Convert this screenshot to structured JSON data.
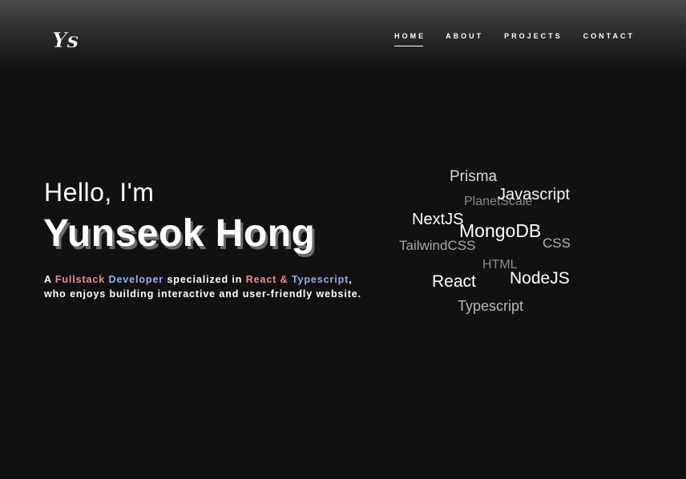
{
  "brand": {
    "logo_text": "Ys"
  },
  "nav": {
    "items": [
      {
        "label": "HOME",
        "active": true
      },
      {
        "label": "ABOUT",
        "active": false
      },
      {
        "label": "PROJECTS",
        "active": false
      },
      {
        "label": "CONTACT",
        "active": false
      }
    ]
  },
  "hero": {
    "greeting": "Hello, I'm",
    "name": "Yunseok Hong",
    "tagline": {
      "a": "A",
      "fullstack": "Fullstack",
      "developer": "Developer",
      "specialized_in": "specialized in",
      "react": "React",
      "amp": "&",
      "typescript": "Typescript",
      "comma": ",",
      "line2": "who enjoys building interactive and user-friendly website."
    }
  },
  "skills_cloud": {
    "words": [
      {
        "text": "Prisma",
        "tone": "light"
      },
      {
        "text": "PlanetScale",
        "tone": "dim"
      },
      {
        "text": "Javascript",
        "tone": "bright"
      },
      {
        "text": "NextJS",
        "tone": "bright"
      },
      {
        "text": "MongoDB",
        "tone": "bright"
      },
      {
        "text": "TailwindCSS",
        "tone": "mid"
      },
      {
        "text": "CSS",
        "tone": "mid"
      },
      {
        "text": "HTML",
        "tone": "dim"
      },
      {
        "text": "React",
        "tone": "bright"
      },
      {
        "text": "NodeJS",
        "tone": "bright"
      },
      {
        "text": "Typescript",
        "tone": "mid"
      }
    ]
  },
  "colors": {
    "background": "#111111",
    "accent_pink": "#f08a94",
    "accent_blue": "#8fb0f0",
    "text": "#ffffff"
  }
}
